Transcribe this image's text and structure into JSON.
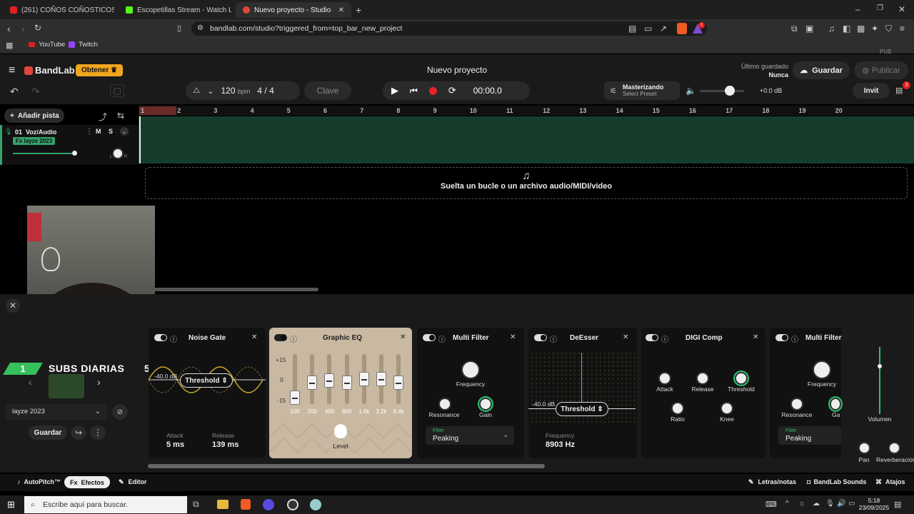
{
  "browser": {
    "tabs": [
      {
        "label": "(261) COÑOS COÑOSTICOS ARISTO..."
      },
      {
        "label": "Escopetillas Stream - Watch Live on..."
      },
      {
        "label": "Nuevo proyecto - Studio"
      }
    ],
    "url": "bandlab.com/studio?triggered_from=top_bar_new_project",
    "bookmarks": [
      "YouTube",
      "Twitch"
    ],
    "ext_badge": "1"
  },
  "header": {
    "logo": "BandLab",
    "obtener": "Obtener",
    "project_title": "Nuevo proyecto",
    "last_saved_label": "Último guardado",
    "last_saved_value": "Nunca",
    "save": "Guardar",
    "publish": "Publicar",
    "pub_badge": "PUB",
    "invite": "Invit",
    "invite_count": "3"
  },
  "transport": {
    "bpm": "120",
    "bpm_unit": "bpm",
    "time_sig_num": "4",
    "time_sig_sep": "/",
    "time_sig_den": "4",
    "key": "Clave",
    "time": "00:00.0",
    "mastering_title": "Masterizando",
    "mastering_sub": "Select Preset",
    "volume_db": "+0.0 dB"
  },
  "tracks_panel": {
    "add_track": "Añadir pista",
    "track_number": "01",
    "track_name": "Voz/Audio",
    "mute": "M",
    "solo": "S",
    "fx_tag": "Fx layze 2023",
    "pan_l": "L",
    "pan_r": "R"
  },
  "ruler": [
    "1",
    "2",
    "3",
    "4",
    "5",
    "6",
    "7",
    "8",
    "9",
    "10",
    "11",
    "12",
    "13",
    "14",
    "15",
    "16",
    "17",
    "18",
    "19",
    "20"
  ],
  "drop_zone": "Suelta un bucle o un archivo audio/MIDI/video",
  "overlay": {
    "rank": "1",
    "text": "SUBS DIARIAS",
    "count": "5"
  },
  "preset": {
    "name": "layze 2023",
    "save": "Guardar"
  },
  "effects": {
    "noise_gate": {
      "title": "Noise Gate",
      "threshold_db": "-40.0 dB",
      "threshold": "Threshold",
      "attack_label": "Attack",
      "attack": "5 ms",
      "release_label": "Release",
      "release": "139 ms"
    },
    "graphic_eq": {
      "title": "Graphic EQ",
      "scale": [
        "+15",
        "0",
        "-15"
      ],
      "bands": [
        "100",
        "200",
        "400",
        "800",
        "1.6k",
        "3.2k",
        "6.4k"
      ],
      "band_gain": [
        -11,
        -2,
        -1,
        -2,
        0,
        0,
        -2
      ],
      "level": "Level"
    },
    "multi_filter": {
      "title": "Multi Filter",
      "frequency": "Frequency",
      "resonance": "Resonance",
      "gain": "Gain",
      "filter_label": "Filter",
      "filter_value": "Peaking"
    },
    "desser": {
      "title": "DeEsser",
      "threshold_db": "-40.0 dB",
      "threshold": "Threshold",
      "freq_label": "Frequency",
      "freq_value": "8903 Hz"
    },
    "digi_comp": {
      "title": "DIGI Comp",
      "attack": "Attack",
      "release": "Release",
      "threshold": "Threshold",
      "ratio": "Ratio",
      "knee": "Knee"
    },
    "multi_filter2": {
      "title": "Multi Filter",
      "frequency": "Frequency",
      "resonance": "Resonance",
      "gain": "Ga",
      "filter_label": "Filter",
      "filter_value": "Peaking"
    },
    "volume": "Volumen",
    "pan": "Pan",
    "reverb": "Reverberación"
  },
  "footer": {
    "autopitch": "AutoPitch™",
    "effects": "Efectos",
    "editor": "Editor",
    "lyrics": "Letras/notas",
    "sounds": "BandLab Sounds",
    "shortcuts": "Atajos"
  },
  "taskbar": {
    "search": "Escribe aquí para buscar.",
    "time": "5:18",
    "date": "23/09/2025"
  }
}
